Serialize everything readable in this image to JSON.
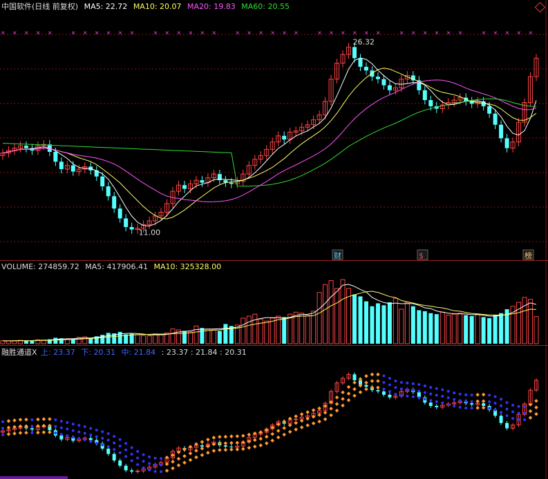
{
  "main_header": {
    "title": "中国软件(日线 前复权)",
    "ma5": "MA5: 22.72",
    "ma10": "MA10: 20.07",
    "ma20": "MA20: 19.83",
    "ma60": "MA60: 20.55"
  },
  "volume_header": {
    "volume": "VOLUME: 274859.72",
    "ma5": "MA5: 417906.41",
    "ma10": "MA10: 325328.00"
  },
  "indicator_header": {
    "name": "融胜通道X",
    "upper": "上: 23.37",
    "lower": "下: 20.31",
    "middle": "中: 21.84",
    "values": ": 23.37 : 21.84 : 20.31"
  },
  "markers": {
    "high_label": "26.32",
    "low_label": "11.00",
    "tag_cai": "财",
    "tag_dollar": "$",
    "tag_bang": "榜"
  },
  "colors": {
    "up": "#ff4444",
    "down": "#54ffff",
    "ma5": "#ffffff",
    "ma10": "#ffff66",
    "ma20": "#ff55ff",
    "ma60": "#33dd33",
    "channel_upper": "#3333ff",
    "channel_middle": "#ff9933"
  },
  "chart_data": {
    "type": "candlestick",
    "price_range": [
      10.4,
      27.2
    ],
    "high_marker": 26.32,
    "low_marker": 11.0,
    "closes": [
      17.3,
      17.5,
      17.7,
      17.9,
      17.7,
      17.5,
      17.9,
      18.0,
      17.4,
      16.6,
      16.0,
      16.3,
      15.8,
      16.0,
      16.2,
      15.9,
      15.4,
      14.6,
      13.8,
      12.8,
      12.0,
      11.3,
      11.1,
      11.2,
      11.5,
      11.8,
      12.2,
      12.5,
      13.2,
      14.2,
      14.7,
      14.4,
      14.8,
      15.1,
      14.9,
      15.3,
      15.6,
      15.1,
      14.9,
      14.8,
      15.0,
      15.6,
      16.3,
      16.8,
      17.1,
      17.6,
      18.2,
      18.7,
      18.4,
      19.0,
      19.1,
      19.4,
      19.6,
      20.0,
      20.4,
      21.5,
      23.3,
      24.6,
      25.3,
      25.9,
      25.0,
      24.3,
      24.0,
      23.5,
      23.3,
      22.8,
      22.4,
      22.6,
      23.3,
      23.6,
      23.2,
      22.4,
      21.6,
      21.1,
      20.9,
      21.2,
      21.4,
      21.6,
      21.8,
      21.5,
      21.3,
      21.5,
      21.1,
      20.5,
      19.6,
      18.5,
      17.7,
      18.2,
      19.8,
      21.4,
      23.5,
      25.0
    ],
    "volume_range": [
      0,
      700000
    ],
    "volumes": [
      30000,
      28000,
      32000,
      35000,
      30000,
      33000,
      40000,
      38000,
      45000,
      60000,
      55000,
      50000,
      48000,
      65000,
      70000,
      60000,
      75000,
      90000,
      110000,
      105000,
      120000,
      95000,
      100000,
      90000,
      85000,
      80000,
      100000,
      95000,
      110000,
      150000,
      140000,
      130000,
      120000,
      180000,
      160000,
      150000,
      140000,
      130000,
      200000,
      180000,
      190000,
      260000,
      280000,
      300000,
      250000,
      230000,
      260000,
      280000,
      270000,
      300000,
      320000,
      310000,
      290000,
      330000,
      520000,
      600000,
      640000,
      560000,
      650000,
      560000,
      500000,
      480000,
      430000,
      380000,
      410000,
      390000,
      420000,
      460000,
      350000,
      420000,
      380000,
      340000,
      330000,
      310000,
      300000,
      320000,
      290000,
      300000,
      310000,
      290000,
      280000,
      300000,
      270000,
      260000,
      290000,
      310000,
      350000,
      380000,
      420000,
      470000,
      450000,
      275000
    ],
    "channel": {
      "upper": 23.37,
      "middle": 21.84,
      "lower": 20.31
    }
  }
}
